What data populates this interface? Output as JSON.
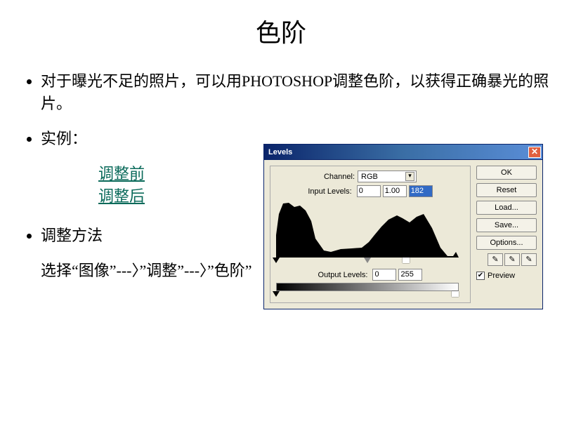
{
  "title": "色阶",
  "bullets": {
    "intro": "对于曝光不足的照片，可以用PHOTOSHOP调整色阶，以获得正确暴光的照片。",
    "example_label": "实例：",
    "before_link": "调整前",
    "after_link": "调整后",
    "method_label": "调整方法",
    "select_line": "选择“图像”---〉”调整”---〉”色阶”"
  },
  "ps": {
    "title": "Levels",
    "channel_label": "Channel:",
    "channel_value": "RGB",
    "input_levels_label": "Input Levels:",
    "input_levels": {
      "low": "0",
      "mid": "1.00",
      "high": "182"
    },
    "output_levels_label": "Output Levels:",
    "output_levels": {
      "low": "0",
      "high": "255"
    },
    "buttons": {
      "ok": "OK",
      "reset": "Reset",
      "load": "Load...",
      "save": "Save...",
      "options": "Options..."
    },
    "preview_label": " Preview",
    "preview_checked": "✔",
    "close_glyph": "✕"
  }
}
